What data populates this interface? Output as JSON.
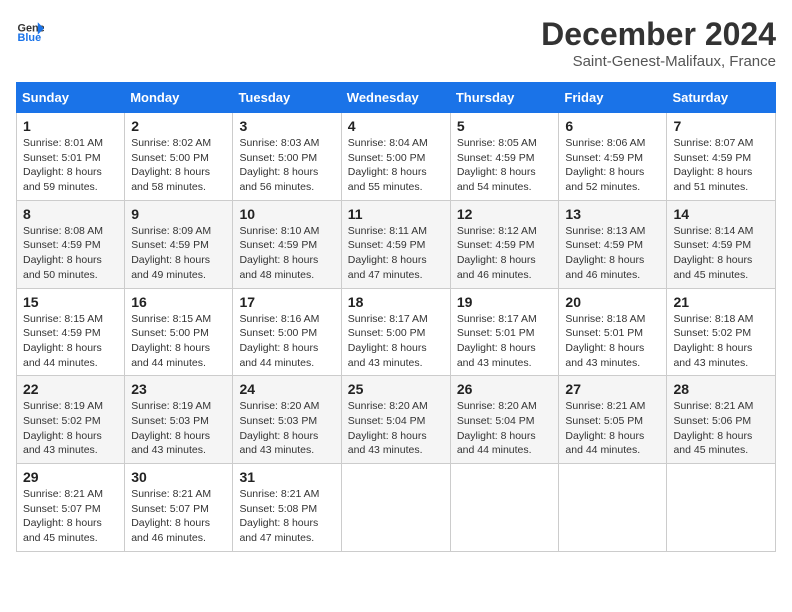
{
  "header": {
    "logo_line1": "General",
    "logo_line2": "Blue",
    "month_title": "December 2024",
    "location": "Saint-Genest-Malifaux, France"
  },
  "days_of_week": [
    "Sunday",
    "Monday",
    "Tuesday",
    "Wednesday",
    "Thursday",
    "Friday",
    "Saturday"
  ],
  "weeks": [
    [
      {
        "day": 1,
        "sunrise": "8:01 AM",
        "sunset": "5:01 PM",
        "daylight": "8 hours and 59 minutes."
      },
      {
        "day": 2,
        "sunrise": "8:02 AM",
        "sunset": "5:00 PM",
        "daylight": "8 hours and 58 minutes."
      },
      {
        "day": 3,
        "sunrise": "8:03 AM",
        "sunset": "5:00 PM",
        "daylight": "8 hours and 56 minutes."
      },
      {
        "day": 4,
        "sunrise": "8:04 AM",
        "sunset": "5:00 PM",
        "daylight": "8 hours and 55 minutes."
      },
      {
        "day": 5,
        "sunrise": "8:05 AM",
        "sunset": "4:59 PM",
        "daylight": "8 hours and 54 minutes."
      },
      {
        "day": 6,
        "sunrise": "8:06 AM",
        "sunset": "4:59 PM",
        "daylight": "8 hours and 52 minutes."
      },
      {
        "day": 7,
        "sunrise": "8:07 AM",
        "sunset": "4:59 PM",
        "daylight": "8 hours and 51 minutes."
      }
    ],
    [
      {
        "day": 8,
        "sunrise": "8:08 AM",
        "sunset": "4:59 PM",
        "daylight": "8 hours and 50 minutes."
      },
      {
        "day": 9,
        "sunrise": "8:09 AM",
        "sunset": "4:59 PM",
        "daylight": "8 hours and 49 minutes."
      },
      {
        "day": 10,
        "sunrise": "8:10 AM",
        "sunset": "4:59 PM",
        "daylight": "8 hours and 48 minutes."
      },
      {
        "day": 11,
        "sunrise": "8:11 AM",
        "sunset": "4:59 PM",
        "daylight": "8 hours and 47 minutes."
      },
      {
        "day": 12,
        "sunrise": "8:12 AM",
        "sunset": "4:59 PM",
        "daylight": "8 hours and 46 minutes."
      },
      {
        "day": 13,
        "sunrise": "8:13 AM",
        "sunset": "4:59 PM",
        "daylight": "8 hours and 46 minutes."
      },
      {
        "day": 14,
        "sunrise": "8:14 AM",
        "sunset": "4:59 PM",
        "daylight": "8 hours and 45 minutes."
      }
    ],
    [
      {
        "day": 15,
        "sunrise": "8:15 AM",
        "sunset": "4:59 PM",
        "daylight": "8 hours and 44 minutes."
      },
      {
        "day": 16,
        "sunrise": "8:15 AM",
        "sunset": "5:00 PM",
        "daylight": "8 hours and 44 minutes."
      },
      {
        "day": 17,
        "sunrise": "8:16 AM",
        "sunset": "5:00 PM",
        "daylight": "8 hours and 44 minutes."
      },
      {
        "day": 18,
        "sunrise": "8:17 AM",
        "sunset": "5:00 PM",
        "daylight": "8 hours and 43 minutes."
      },
      {
        "day": 19,
        "sunrise": "8:17 AM",
        "sunset": "5:01 PM",
        "daylight": "8 hours and 43 minutes."
      },
      {
        "day": 20,
        "sunrise": "8:18 AM",
        "sunset": "5:01 PM",
        "daylight": "8 hours and 43 minutes."
      },
      {
        "day": 21,
        "sunrise": "8:18 AM",
        "sunset": "5:02 PM",
        "daylight": "8 hours and 43 minutes."
      }
    ],
    [
      {
        "day": 22,
        "sunrise": "8:19 AM",
        "sunset": "5:02 PM",
        "daylight": "8 hours and 43 minutes."
      },
      {
        "day": 23,
        "sunrise": "8:19 AM",
        "sunset": "5:03 PM",
        "daylight": "8 hours and 43 minutes."
      },
      {
        "day": 24,
        "sunrise": "8:20 AM",
        "sunset": "5:03 PM",
        "daylight": "8 hours and 43 minutes."
      },
      {
        "day": 25,
        "sunrise": "8:20 AM",
        "sunset": "5:04 PM",
        "daylight": "8 hours and 43 minutes."
      },
      {
        "day": 26,
        "sunrise": "8:20 AM",
        "sunset": "5:04 PM",
        "daylight": "8 hours and 44 minutes."
      },
      {
        "day": 27,
        "sunrise": "8:21 AM",
        "sunset": "5:05 PM",
        "daylight": "8 hours and 44 minutes."
      },
      {
        "day": 28,
        "sunrise": "8:21 AM",
        "sunset": "5:06 PM",
        "daylight": "8 hours and 45 minutes."
      }
    ],
    [
      {
        "day": 29,
        "sunrise": "8:21 AM",
        "sunset": "5:07 PM",
        "daylight": "8 hours and 45 minutes."
      },
      {
        "day": 30,
        "sunrise": "8:21 AM",
        "sunset": "5:07 PM",
        "daylight": "8 hours and 46 minutes."
      },
      {
        "day": 31,
        "sunrise": "8:21 AM",
        "sunset": "5:08 PM",
        "daylight": "8 hours and 47 minutes."
      },
      null,
      null,
      null,
      null
    ]
  ]
}
